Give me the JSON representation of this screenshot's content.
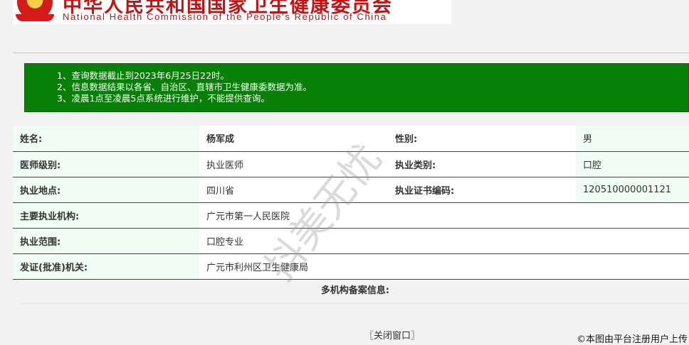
{
  "header": {
    "title_cn": "中华人民共和国国家卫生健康委员会",
    "title_en": "National Health Commission of the People's Republic of China"
  },
  "notice": {
    "lines": [
      "1、查询数据截止到2023年6月25日22时。",
      "2、信息数据结果以各省、自治区、直辖市卫生健康委数据为准。",
      "3、凌晨1点至凌晨5点系统进行维护，不能提供查询。"
    ]
  },
  "info": {
    "name_label": "姓名:",
    "name_value": "杨军成",
    "gender_label": "性别:",
    "gender_value": "男",
    "level_label": "医师级别:",
    "level_value": "执业医师",
    "category_label": "执业类别:",
    "category_value": "口腔",
    "location_label": "执业地点:",
    "location_value": "四川省",
    "cert_label": "执业证书编码:",
    "cert_value": "120510000001121",
    "institution_label": "主要执业机构:",
    "institution_value": "广元市第一人民医院",
    "scope_label": "执业范围:",
    "scope_value": "口腔专业",
    "authority_label": "发证(批准)机关:",
    "authority_value": "广元市利州区卫生健康局"
  },
  "multi_institution_label": "多机构备案信息:",
  "close_button": "〖关闭窗口〗",
  "watermark": "抖美无忧",
  "copyright": "©本图由平台注册用户上传",
  "colors": {
    "notice_bg": "#088008",
    "header_red": "#c41111",
    "row_border": "#1e5a3c",
    "label_bg": "#f0fdf5"
  }
}
